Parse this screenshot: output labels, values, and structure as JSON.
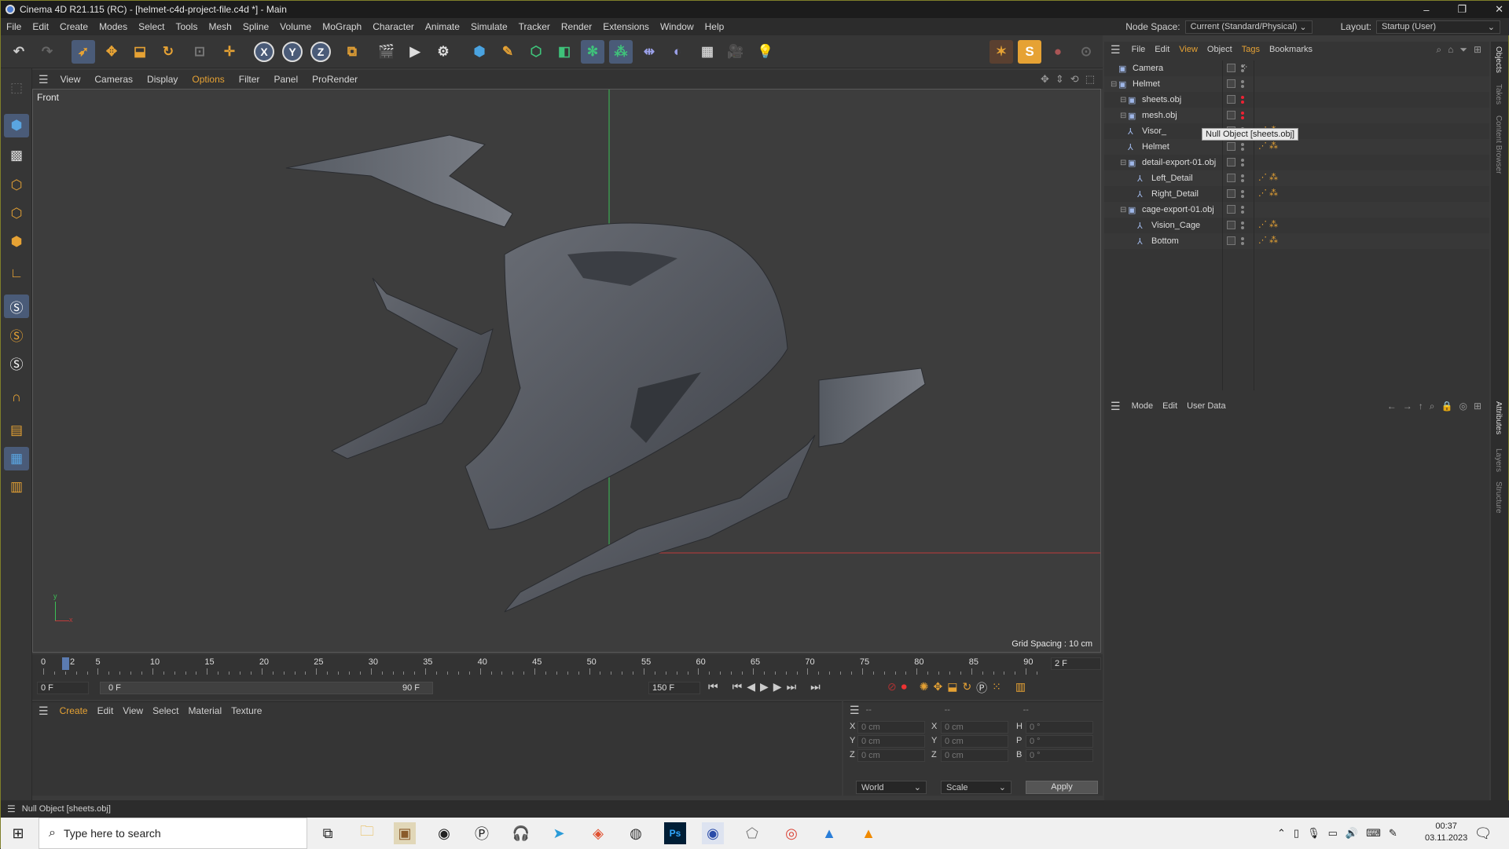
{
  "window": {
    "title": "Cinema 4D R21.115 (RC) - [helmet-c4d-project-file.c4d *] - Main",
    "min": "–",
    "max": "❐",
    "close": "✕"
  },
  "menu": [
    "File",
    "Edit",
    "Create",
    "Modes",
    "Select",
    "Tools",
    "Mesh",
    "Spline",
    "Volume",
    "MoGraph",
    "Character",
    "Animate",
    "Simulate",
    "Tracker",
    "Render",
    "Extensions",
    "Window",
    "Help"
  ],
  "nodespace": {
    "label": "Node Space:",
    "value": "Current (Standard/Physical)",
    "layout_label": "Layout:",
    "layout_value": "Startup (User)"
  },
  "toolbar": {
    "x": "X",
    "y": "Y",
    "z": "Z"
  },
  "viewport": {
    "menu": [
      "View",
      "Cameras",
      "Display",
      "Options",
      "Filter",
      "Panel",
      "ProRender"
    ],
    "active_menu": "Options",
    "view_name": "Front",
    "grid_spacing": "Grid Spacing : 10 cm",
    "axis_x": "x",
    "axis_y": "y"
  },
  "timeline": {
    "ticks": [
      "0",
      "5",
      "10",
      "15",
      "20",
      "25",
      "30",
      "35",
      "40",
      "45",
      "50",
      "55",
      "60",
      "65",
      "70",
      "75",
      "80",
      "85",
      "90"
    ],
    "current_marker": "2",
    "current_frame": "2 F",
    "start": "0 F",
    "range_start": "0 F",
    "range_end": "90 F",
    "end": "150 F"
  },
  "objects": {
    "menu": [
      "File",
      "Edit",
      "View",
      "Object",
      "Tags",
      "Bookmarks"
    ],
    "items": [
      {
        "name": "Camera",
        "indent": 0
      },
      {
        "name": "Helmet",
        "indent": 0
      },
      {
        "name": "sheets.obj",
        "indent": 1
      },
      {
        "name": "mesh.obj",
        "indent": 1
      },
      {
        "name": "Visor_",
        "indent": 1
      },
      {
        "name": "Helmet",
        "indent": 1
      },
      {
        "name": "detail-export-01.obj",
        "indent": 1
      },
      {
        "name": "Left_Detail",
        "indent": 2
      },
      {
        "name": "Right_Detail",
        "indent": 2
      },
      {
        "name": "cage-export-01.obj",
        "indent": 1
      },
      {
        "name": "Vision_Cage",
        "indent": 2
      },
      {
        "name": "Bottom",
        "indent": 2
      }
    ],
    "tooltip": "Null Object [sheets.obj]"
  },
  "attributes": {
    "menu": [
      "Mode",
      "Edit",
      "User Data"
    ]
  },
  "right_tabs": [
    "Objects",
    "Takes",
    "Content Browser",
    "Attributes",
    "Layers",
    "Structure"
  ],
  "material": {
    "menu": [
      "Create",
      "Edit",
      "View",
      "Select",
      "Material",
      "Texture"
    ]
  },
  "coords": {
    "header": [
      "--",
      "--",
      "--"
    ],
    "rows": [
      {
        "a": "X",
        "av": "0 cm",
        "b": "X",
        "bv": "0 cm",
        "c": "H",
        "cv": "0 °"
      },
      {
        "a": "Y",
        "av": "0 cm",
        "b": "Y",
        "bv": "0 cm",
        "c": "P",
        "cv": "0 °"
      },
      {
        "a": "Z",
        "av": "0 cm",
        "b": "Z",
        "bv": "0 cm",
        "c": "B",
        "cv": "0 °"
      }
    ],
    "world": "World",
    "scale": "Scale",
    "apply": "Apply"
  },
  "status": "Null Object [sheets.obj]",
  "taskbar": {
    "search": "Type here to search",
    "time": "00:37",
    "date": "03.11.2023"
  }
}
